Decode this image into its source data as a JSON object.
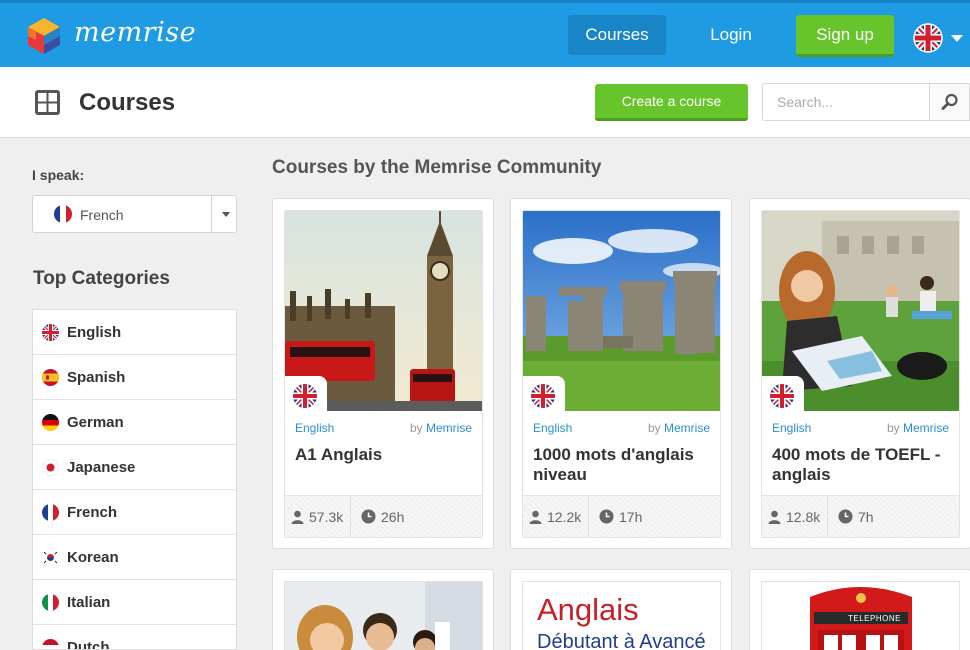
{
  "topbar": {
    "brand": "memrise",
    "nav": {
      "courses": "Courses",
      "login": "Login",
      "signup": "Sign up"
    },
    "language_flag": "uk-flag-icon"
  },
  "subheader": {
    "title": "Courses",
    "create_button": "Create a course",
    "search_placeholder": "Search..."
  },
  "sidebar": {
    "speak_label": "I speak:",
    "speak_value": "French",
    "categories_title": "Top Categories",
    "categories": [
      {
        "label": "English",
        "flag": "uk"
      },
      {
        "label": "Spanish",
        "flag": "spain"
      },
      {
        "label": "German",
        "flag": "germany"
      },
      {
        "label": "Japanese",
        "flag": "japan"
      },
      {
        "label": "French",
        "flag": "france"
      },
      {
        "label": "Korean",
        "flag": "korea"
      },
      {
        "label": "Italian",
        "flag": "italy"
      },
      {
        "label": "Dutch",
        "flag": "netherlands"
      }
    ]
  },
  "main": {
    "section_title": "Courses by the Memrise Community",
    "courses": [
      {
        "language": "English",
        "by_prefix": "by",
        "author": "Memrise",
        "name": "A1 Anglais",
        "learners": "57.3k",
        "time": "26h",
        "image": "big-ben-london"
      },
      {
        "language": "English",
        "by_prefix": "by",
        "author": "Memrise",
        "name": "1000 mots d'anglais niveau",
        "learners": "12.2k",
        "time": "17h",
        "image": "stonehenge"
      },
      {
        "language": "English",
        "by_prefix": "by",
        "author": "Memrise",
        "name": "400 mots de TOEFL - anglais",
        "learners": "12.8k",
        "time": "7h",
        "image": "student-on-grass"
      }
    ],
    "second_row": [
      {
        "image": "smiling-people"
      },
      {
        "title_line1": "Anglais",
        "title_line2": "Débutant à Avancé"
      },
      {
        "image": "red-telephone-box",
        "sign": "TELEPHONE"
      }
    ],
    "colors": {
      "accent_blue": "#1e9be2",
      "green": "#67c42a"
    }
  }
}
